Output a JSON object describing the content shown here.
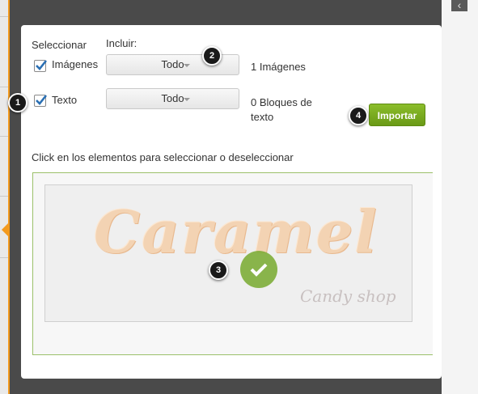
{
  "dialog": {
    "select_header": "Seleccionar",
    "include_header": "Incluir:",
    "images": {
      "label": "Imágenes",
      "checked": true,
      "include": "Todo",
      "count": "1 Imágenes"
    },
    "text": {
      "label": "Texto",
      "checked": true,
      "include": "Todo",
      "count_line1": "0 Bloques de",
      "count_line2": "texto"
    },
    "import_button": "Importar",
    "instruction": "Click en los elementos para seleccionar o  deseleccionar",
    "preview": {
      "logo_text": "Caramel",
      "logo_tagline": "Candy shop",
      "selected": true
    }
  },
  "callouts": [
    "1",
    "2",
    "3",
    "4"
  ],
  "icons": {
    "collapse": "chevron-left-icon",
    "selected": "checkmark-icon"
  },
  "colors": {
    "accent": "#f39a1e",
    "import_button": "#7aab20",
    "preview_border": "#9bc06a",
    "checkbox": "#2a6fb3"
  }
}
